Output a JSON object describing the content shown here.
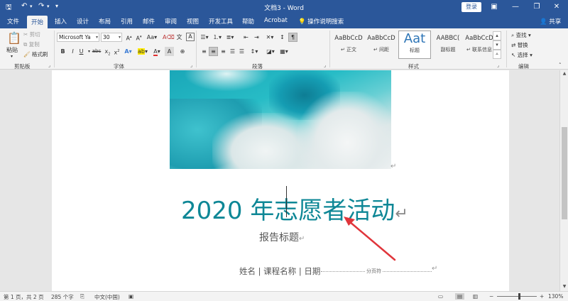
{
  "window": {
    "title": "文档3  -  Word",
    "login_label": "登录",
    "quick_access": {
      "undo_icon": "↶",
      "redo_icon": "↷",
      "save_icon": "🖫",
      "customize_icon": "▾"
    }
  },
  "tabs": [
    {
      "label": "文件"
    },
    {
      "label": "开始"
    },
    {
      "label": "插入"
    },
    {
      "label": "设计"
    },
    {
      "label": "布局"
    },
    {
      "label": "引用"
    },
    {
      "label": "邮件"
    },
    {
      "label": "审阅"
    },
    {
      "label": "视图"
    },
    {
      "label": "开发工具"
    },
    {
      "label": "帮助"
    },
    {
      "label": "Acrobat"
    }
  ],
  "tell_me": "操作说明搜索",
  "share": "共享",
  "ribbon": {
    "clipboard": {
      "paste": "粘贴",
      "cut": "剪切",
      "copy": "复制",
      "format_painter": "格式刷",
      "label": "剪贴板"
    },
    "font": {
      "font_name": "Microsoft Ya",
      "font_size": "30",
      "label": "字体"
    },
    "paragraph": {
      "label": "段落"
    },
    "styles": {
      "label": "样式",
      "items": [
        {
          "sample": "AaBbCcD",
          "name": "↵ 正文"
        },
        {
          "sample": "AaBbCcD",
          "name": "↵ 间距"
        },
        {
          "sample": "Aat",
          "name": "标题"
        },
        {
          "sample": "AABBC(",
          "name": "副标题"
        },
        {
          "sample": "AaBbCcD",
          "name": "↵ 联系信息"
        }
      ]
    },
    "editing": {
      "find": "查找",
      "replace": "替换",
      "select": "选择",
      "label": "编辑"
    }
  },
  "document": {
    "title": "2020 年志愿者活动",
    "subtitle": "报告标题",
    "meta": "姓名 | 课程名称 | 日期",
    "page_break_label": "分页符"
  },
  "statusbar": {
    "page": "第 1 页，共 2 页",
    "words": "285 个字",
    "language": "中文(中国)",
    "zoom": "130%"
  },
  "colors": {
    "brand": "#2b579a",
    "title_teal": "#0e8796",
    "annotation": "#e0353b"
  }
}
